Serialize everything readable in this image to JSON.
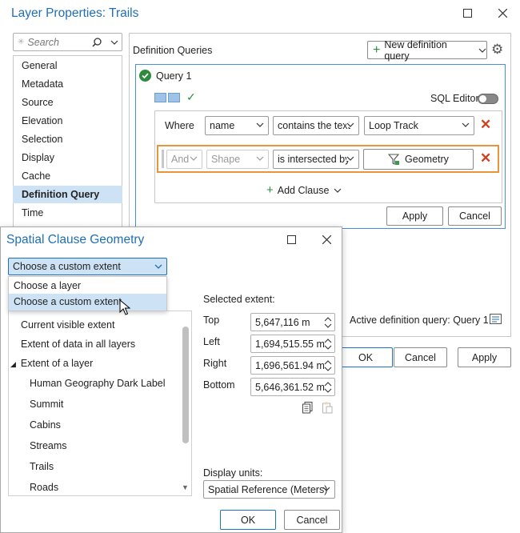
{
  "main_window": {
    "title": "Layer Properties: Trails"
  },
  "nav": {
    "search_placeholder": "Search",
    "items": [
      "General",
      "Metadata",
      "Source",
      "Elevation",
      "Selection",
      "Display",
      "Cache",
      "Definition Query",
      "Time"
    ],
    "selected": "Definition Query"
  },
  "defq": {
    "heading": "Definition Queries",
    "new_button": "New definition query",
    "query_name": "Query 1",
    "sql_editor": "SQL Editor",
    "row1": {
      "where": "Where",
      "field": "name",
      "operator": "contains the text",
      "value": "Loop Track"
    },
    "row2": {
      "conj": "And",
      "field": "Shape",
      "operator": "is intersected by",
      "value": "Geometry"
    },
    "add_clause": "Add Clause",
    "apply": "Apply",
    "cancel": "Cancel"
  },
  "footer": {
    "active_label": "Active definition query: Query 1",
    "ok": "OK",
    "cancel": "Cancel",
    "apply": "Apply"
  },
  "spatial": {
    "title": "Spatial Clause Geometry",
    "extent_select": "Choose a custom extent",
    "dropdown_options": [
      "Choose a layer",
      "Choose a custom extent"
    ],
    "tree": {
      "current": "Current visible extent",
      "all": "Extent of data in all layers",
      "layer_group": "Extent of a layer",
      "layers": [
        "Human Geography Dark Label",
        "Summit",
        "Cabins",
        "Streams",
        "Trails",
        "Roads"
      ]
    },
    "selected_extent": "Selected extent:",
    "extent": {
      "top_label": "Top",
      "top": "5,647,116 m",
      "left_label": "Left",
      "left": "1,694,515.55 m",
      "right_label": "Right",
      "right": "1,696,561.94 m",
      "bottom_label": "Bottom",
      "bottom": "5,646,361.52 m"
    },
    "display_units_label": "Display units:",
    "display_units": "Spatial Reference (Meters)",
    "ok": "OK",
    "cancel": "Cancel"
  },
  "colors": {
    "accent": "#1f6fb5",
    "highlight": "#e8963c",
    "green": "#2e8b3e",
    "delete": "#d04020"
  }
}
